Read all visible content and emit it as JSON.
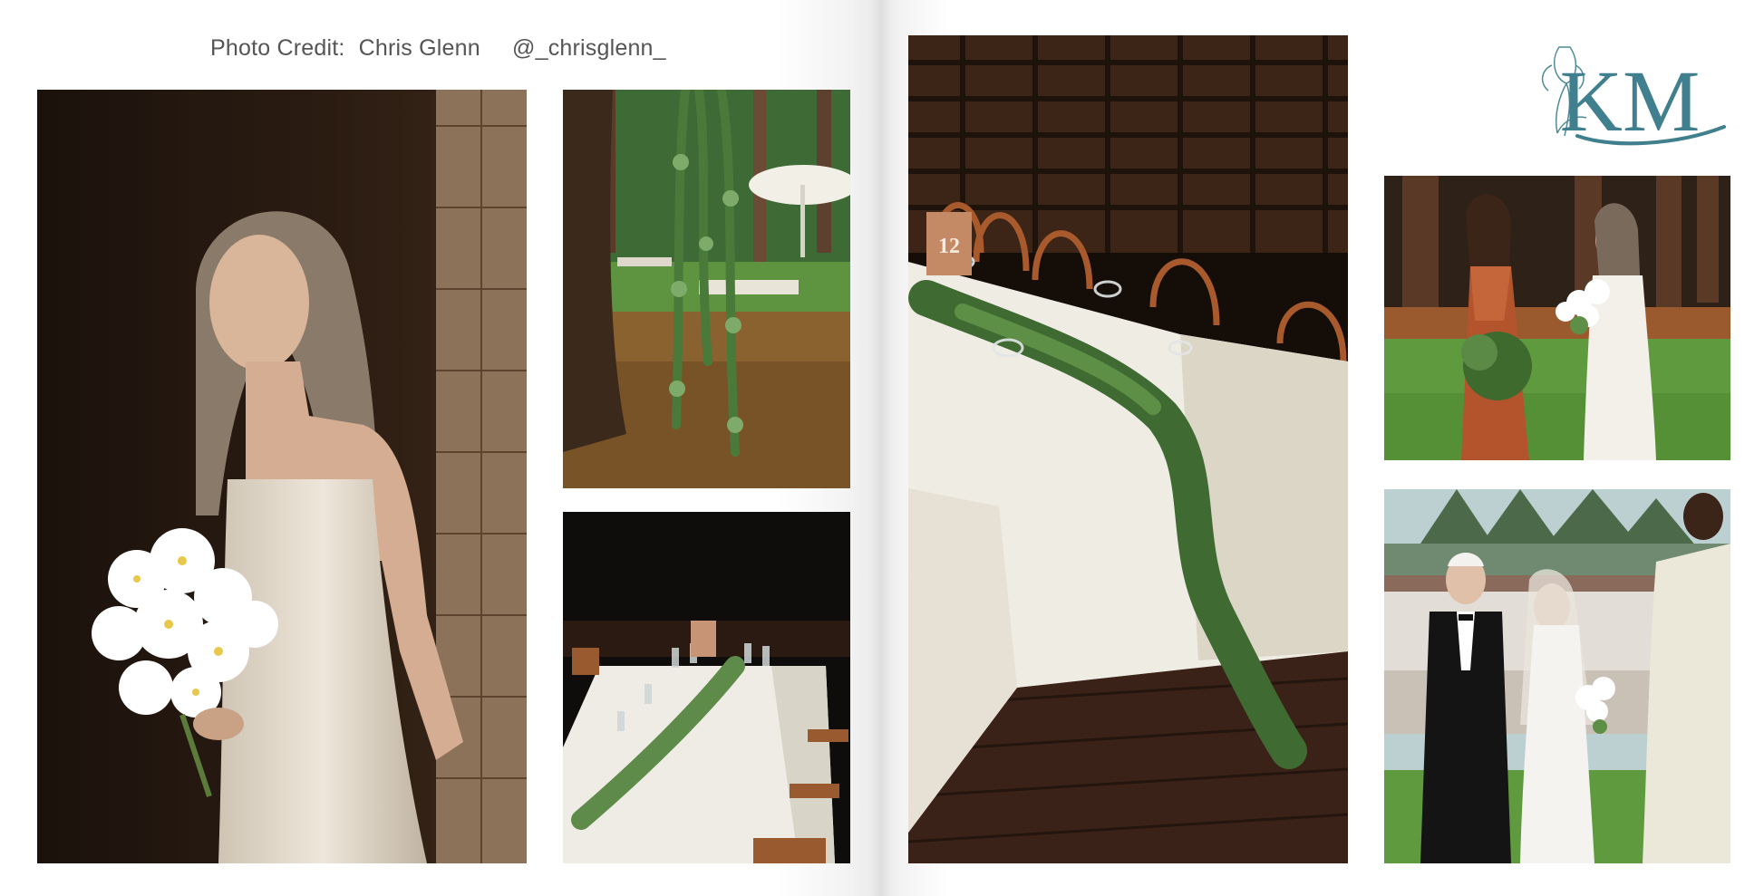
{
  "credit": {
    "label": "Photo Credit:",
    "photographer": "Chris Glenn",
    "handle": "@_chrisglenn_"
  },
  "logo": {
    "monogram": "KM",
    "color": "#3f7f8e"
  },
  "photos": [
    {
      "id": "bride-portrait",
      "subject": "bride in white slip dress holding white cosmos bouquet by shingled wall"
    },
    {
      "id": "hanging-greenery",
      "subject": "hanging greenery installation from tree with white umbrella in forest lawn"
    },
    {
      "id": "long-table-1",
      "subject": "long reception table with white linens, glassware and table number 1"
    },
    {
      "id": "table-12",
      "subject": "reception table with eucalyptus garland and table number 12",
      "table_number": "12"
    },
    {
      "id": "bride-bridesmaid",
      "subject": "bride laughing with bridesmaid in rust dress on lawn"
    },
    {
      "id": "processional",
      "subject": "father walking bride down the aisle with officiant"
    }
  ],
  "colors": {
    "rust": "#b4542c",
    "greenery": "#3f6a32",
    "linen": "#f1ede2",
    "wood": "#4a2e22"
  }
}
